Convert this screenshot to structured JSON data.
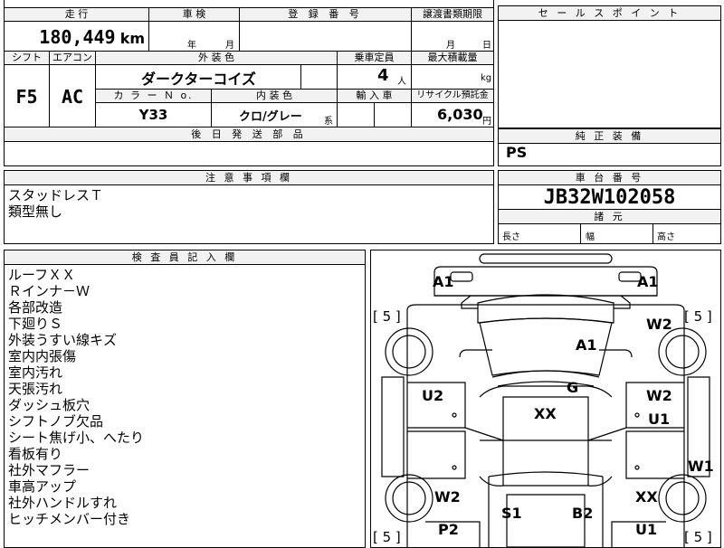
{
  "top": {
    "mileage_label": "走 行",
    "mileage_value": "180,449",
    "mileage_unit": "km",
    "inspection_label": "車 検",
    "inspection_year": "年",
    "inspection_month": "月",
    "registration_label": "登 録 番 号",
    "transfer_doc_label": "譲渡書類期限",
    "transfer_month": "月",
    "transfer_day": "日",
    "shift_label": "シフト",
    "shift_value": "F5",
    "ac_label": "エアコン",
    "ac_value": "AC",
    "exterior_color_label": "外 装 色",
    "exterior_color_value": "ダークターコイズ",
    "capacity_label": "乗車定員",
    "capacity_value": "4",
    "capacity_unit": "人",
    "max_load_label": "最大積載量",
    "max_load_unit": "kg",
    "color_no_label": "カ ラ ー Ｎ o.",
    "color_no_value": "Y33",
    "interior_color_label": "内 装 色",
    "interior_color_value": "クロ/グレー",
    "interior_color_suffix": "系",
    "import_label": "輸 入 車",
    "recycle_label": "リサイクル預託金",
    "recycle_value": "6,030",
    "recycle_unit": "円",
    "later_parts_label": "後 日 発 送 部 品"
  },
  "sales_point": {
    "label": "セ ー ル ス ポ イ ン ト"
  },
  "genuine_equipment": {
    "label": "純 正 装 備",
    "value": "PS"
  },
  "notes": {
    "label": "注 意 事 項 欄",
    "lines": [
      "スタッドレスＴ",
      "類型無し"
    ]
  },
  "chassis": {
    "label": "車 台 番 号",
    "value": "JB32W102058",
    "dimensions_label": "諸 元",
    "length_label": "長さ",
    "width_label": "幅",
    "height_label": "高さ"
  },
  "inspector": {
    "label": "検 査 員 記 入 欄",
    "lines": [
      "ルーフＸＸ",
      "Ｒインナ－Ｗ",
      "各部改造",
      "下廻りＳ",
      "外装うすい線キズ",
      "室内内張傷",
      "室内汚れ",
      "天張汚れ",
      "ダッシュ板穴",
      "シフトノブ欠品",
      "シート焦げ小、へたり",
      "看板有り",
      "社外マフラー",
      "車高アップ",
      "社外ハンドルすれ",
      "ヒッチメンバー付き"
    ]
  },
  "diagram": {
    "marks": {
      "front_left": "A1",
      "front_right": "A1",
      "bracket_tl": "[ 5 ]",
      "bracket_tr": "[ 5 ]",
      "bracket_bl": "[ 5 ]",
      "bracket_br": "[ 5 ]",
      "w2_tr": "W2",
      "hood": "A1",
      "u2_left": "U2",
      "g_center": "G",
      "w2_right": "W2",
      "xx_center": "XX",
      "u1_right": "U1",
      "w1_right": "W1",
      "w2_bl": "W2",
      "xx_br": "XX",
      "s1": "S1",
      "b2": "B2",
      "p2": "P2",
      "u1_br": "U1"
    }
  }
}
